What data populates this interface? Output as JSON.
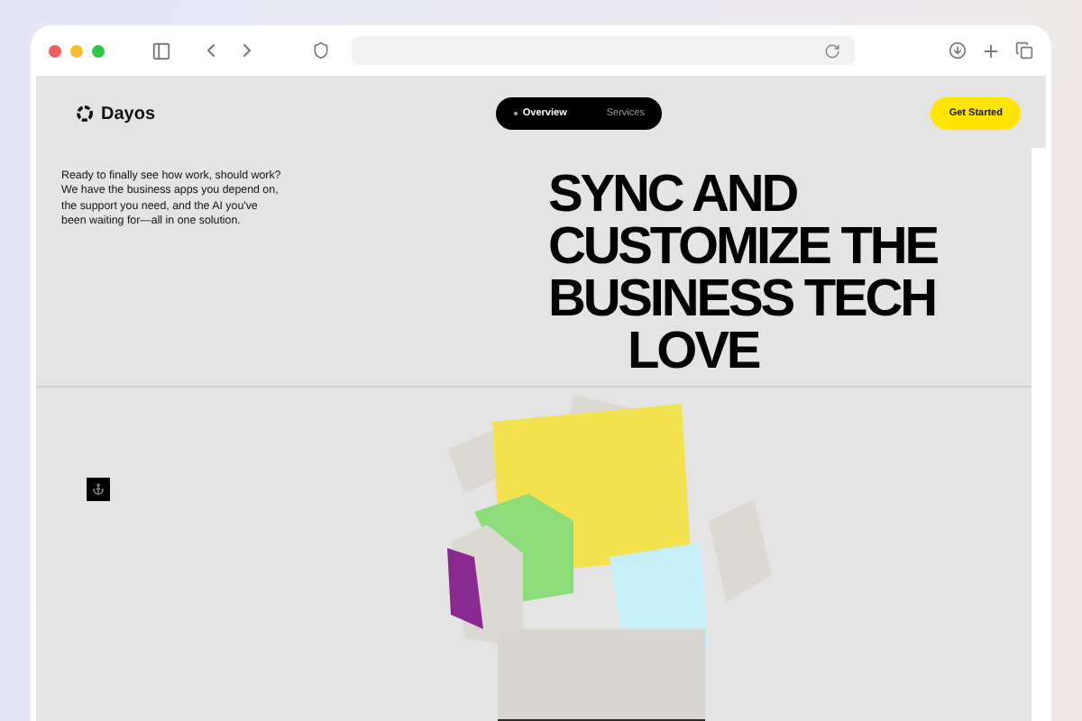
{
  "site": {
    "brand": "Dayos",
    "nav": [
      {
        "label": "Overview",
        "selected": true
      },
      {
        "label": "Services",
        "selected": false
      }
    ],
    "cta": "Get Started",
    "intro": "Ready to finally see how work, should work? We have the business apps you depend on, the support you need, and the AI you've been waiting for—all in one solution.",
    "headline": [
      "SYNC AND",
      "CUSTOMIZE THE",
      "BUSINESS TECH",
      "LOVE"
    ]
  }
}
